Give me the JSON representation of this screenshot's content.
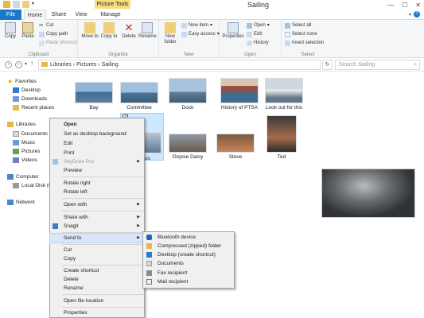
{
  "window": {
    "title": "Sailing",
    "context_tab": "Picture Tools",
    "help": "?"
  },
  "tabs": [
    "File",
    "Home",
    "Share",
    "View",
    "Manage"
  ],
  "ribbon": {
    "clipboard": {
      "label": "Clipboard",
      "copy": "Copy",
      "paste": "Paste",
      "cut": "Cut",
      "copy_path": "Copy path",
      "paste_shortcut": "Paste shortcut"
    },
    "organize": {
      "label": "Organize",
      "move_to": "Move to",
      "copy_to": "Copy to",
      "delete": "Delete",
      "rename": "Rename"
    },
    "new": {
      "label": "New",
      "new_folder": "New folder",
      "new_item": "New item",
      "easy_access": "Easy access"
    },
    "open": {
      "label": "Open",
      "properties": "Properties",
      "open": "Open",
      "edit": "Edit",
      "history": "History"
    },
    "select": {
      "label": "Select",
      "select_all": "Select all",
      "select_none": "Select none",
      "invert": "Invert selection"
    }
  },
  "address": {
    "path": "Libraries  ›  Pictures  ›  Sailing",
    "search_placeholder": "Search Sailing"
  },
  "nav": {
    "favorites": "Favorites",
    "desktop": "Desktop",
    "downloads": "Downloads",
    "recent": "Recent places",
    "libraries": "Libraries",
    "documents": "Documents",
    "music": "Music",
    "pictures": "Pictures",
    "videos": "Videos",
    "computer": "Computer",
    "local_disk": "Local Disk (C",
    "network": "Network"
  },
  "thumbnails": [
    "Bay",
    "Committee",
    "Dock",
    "History of PTSA",
    "Look out for this",
    "",
    "Oopsie Daisy",
    "Steve",
    "Ted"
  ],
  "selected_partial_label": "us",
  "context_menu": {
    "open": "Open",
    "set_bg": "Set as desktop background",
    "edit": "Edit",
    "print": "Print",
    "skydrive": "SkyDrive Pro",
    "preview": "Preview",
    "rotate_right": "Rotate right",
    "rotate_left": "Rotate left",
    "open_with": "Open with",
    "share_with": "Share with",
    "snagit": "Snagit",
    "send_to": "Send to",
    "cut": "Cut",
    "copy": "Copy",
    "create_shortcut": "Create shortcut",
    "delete": "Delete",
    "rename": "Rename",
    "open_location": "Open file location",
    "properties": "Properties"
  },
  "send_to_menu": {
    "bluetooth": "Bluetooth device",
    "compressed": "Compressed (zipped) folder",
    "desktop": "Desktop (create shortcut)",
    "documents": "Documents",
    "fax": "Fax recipient",
    "mail": "Mail recipient"
  },
  "colors": {
    "accent": "#1979ca",
    "context_tab": "#f6df7e",
    "hover": "#d9e6f7",
    "selection": "#cce8ff"
  }
}
